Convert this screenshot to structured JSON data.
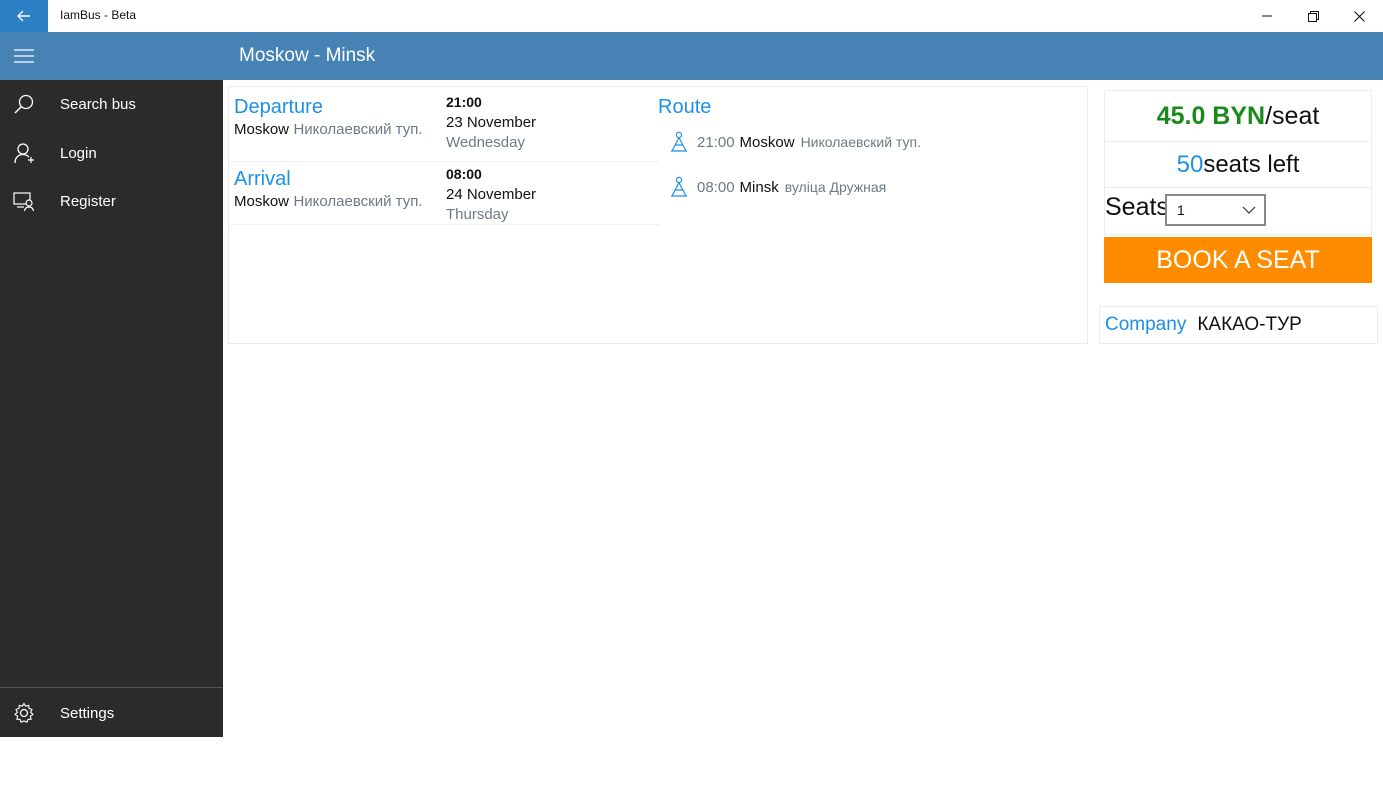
{
  "window": {
    "title": "IamBus - Beta"
  },
  "header": {
    "title": "Moskow - Minsk"
  },
  "sidebar": {
    "items": [
      {
        "label": "Search bus",
        "icon": "search-icon"
      },
      {
        "label": "Login",
        "icon": "user-icon"
      },
      {
        "label": "Register",
        "icon": "register-icon"
      }
    ],
    "settings": {
      "label": "Settings",
      "icon": "gear-icon"
    }
  },
  "trip": {
    "departure": {
      "heading": "Departure",
      "city": "Moskow",
      "station": "Николаевский туп.",
      "time": "21:00",
      "date": "23 November",
      "weekday": "Wednesday"
    },
    "arrival": {
      "heading": "Arrival",
      "city": "Moskow",
      "station": "Николаевский туп.",
      "time": "08:00",
      "date": "24 November",
      "weekday": "Thursday"
    }
  },
  "route": {
    "heading": "Route",
    "stops": [
      {
        "time": "21:00",
        "city": "Moskow",
        "station": "Николаевский туп."
      },
      {
        "time": "08:00",
        "city": "Minsk",
        "station": "вуліца Дружная"
      }
    ]
  },
  "booking": {
    "price": "45.0 BYN",
    "price_unit": "/seat",
    "seats_count": "50",
    "seats_left_label": "seats left",
    "seats_label": "Seats",
    "seats_selected": "1",
    "book_button": "BOOK A SEAT"
  },
  "company": {
    "label": "Company",
    "name": "КАКАО-ТУР"
  },
  "colors": {
    "accent": "#4682b4",
    "back_button": "#2b7fc3",
    "link_blue": "#1e90e6",
    "price_green": "#1a8a1a",
    "book_orange": "#ff8c00",
    "sidebar_bg": "#2b2b2b"
  }
}
